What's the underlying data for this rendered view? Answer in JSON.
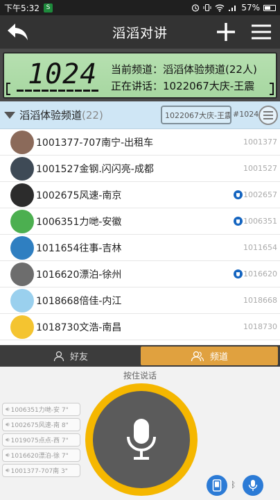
{
  "status": {
    "time": "下午5:32",
    "app_badge": "S",
    "battery": "57%",
    "battery_level": 0.57
  },
  "titlebar": {
    "title": "滔滔对讲"
  },
  "lcd": {
    "channel_number": "1024",
    "current_channel": "当前频道：滔滔体验频道(22人)",
    "speaking": "正在讲话：1022067大庆-王震",
    "signal_bars": 10
  },
  "channel": {
    "name": "滔滔体验频道",
    "count": "(22)",
    "speaker": "1022067大庆-王震",
    "id": "#1024"
  },
  "members": [
    {
      "name": "1001377-707南宁-出租车",
      "id": "1001377",
      "shield": false,
      "avatar_color": "#8b6a5a"
    },
    {
      "name": "1001527金钢.闪闪亮-成都",
      "id": "1001527",
      "shield": false,
      "avatar_color": "#3e4a56"
    },
    {
      "name": "1002675风速-南京",
      "id": "1002657",
      "shield": true,
      "avatar_color": "#2c2c2c"
    },
    {
      "name": "1006351力哋-安徽",
      "id": "1006351",
      "shield": true,
      "avatar_color": "#4caf50"
    },
    {
      "name": "1011654往事-吉林",
      "id": "1011654",
      "shield": false,
      "avatar_color": "#2f7fc1"
    },
    {
      "name": "1016620漂泊-徐州",
      "id": "1016620",
      "shield": true,
      "avatar_color": "#6d6d6d"
    },
    {
      "name": "1018668倍佳-内江",
      "id": "1018668",
      "shield": false,
      "avatar_color": "#9ad0ee"
    },
    {
      "name": "1018730文浩-南昌",
      "id": "1018730",
      "shield": false,
      "avatar_color": "#f4c430"
    }
  ],
  "tabs": [
    {
      "label": "好友",
      "active": false
    },
    {
      "label": "频道",
      "active": true
    }
  ],
  "ptt": {
    "hint": "按住说话"
  },
  "history": [
    {
      "text": "1006351力哋-安 7\""
    },
    {
      "text": "1002675风速-南 8\""
    },
    {
      "text": "1019075点点-西 7\""
    },
    {
      "text": "1016620漂泊-徐 7\""
    },
    {
      "text": "1001377-707南 3\""
    }
  ],
  "colors": {
    "accent": "#f5b700",
    "tab_active": "#e0a13f",
    "lcd_bg": "#a7d7a1",
    "blue": "#2c7bd6"
  }
}
